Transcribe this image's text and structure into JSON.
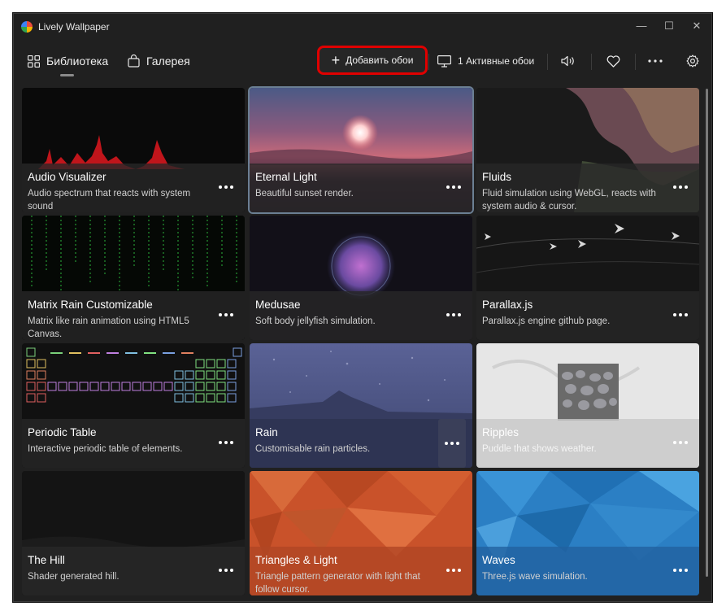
{
  "window": {
    "title": "Lively Wallpaper"
  },
  "titlebar_controls": {
    "minimize": "—",
    "maximize": "☐",
    "close": "✕"
  },
  "nav": {
    "library_label": "Библиотека",
    "gallery_label": "Галерея"
  },
  "toolbar": {
    "add_label": "Добавить обои",
    "active_label": "1 Активные обои"
  },
  "icons": [
    "grid-icon",
    "shopping-bag-icon",
    "plus-icon",
    "monitor-icon",
    "speaker-icon",
    "heart-icon",
    "more-icon",
    "gear-icon"
  ],
  "colors": {
    "highlight": "#e00000",
    "window_bg": "#202020"
  },
  "wallpapers": [
    {
      "title": "Audio Visualizer",
      "desc": "Audio spectrum that reacts with system sound"
    },
    {
      "title": "Eternal Light",
      "desc": "Beautiful sunset render."
    },
    {
      "title": "Fluids",
      "desc": "Fluid simulation using WebGL, reacts with system audio & cursor."
    },
    {
      "title": "Matrix Rain Customizable",
      "desc": "Matrix like rain animation using HTML5 Canvas."
    },
    {
      "title": "Medusae",
      "desc": "Soft body jellyfish simulation."
    },
    {
      "title": "Parallax.js",
      "desc": "Parallax.js engine github page."
    },
    {
      "title": "Periodic Table",
      "desc": "Interactive periodic table of elements."
    },
    {
      "title": "Rain",
      "desc": "Customisable rain particles."
    },
    {
      "title": "Ripples",
      "desc": "Puddle that shows weather."
    },
    {
      "title": "The Hill",
      "desc": "Shader generated hill."
    },
    {
      "title": "Triangles & Light",
      "desc": "Triangle pattern generator with light that follow cursor."
    },
    {
      "title": "Waves",
      "desc": "Three.js wave simulation."
    }
  ]
}
